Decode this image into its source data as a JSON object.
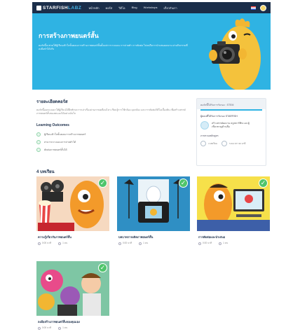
{
  "nav": {
    "logo_main": "STARFISH",
    "logo_accent": "LABZ",
    "items": [
      "หน้าหลัก",
      "คอร์ส",
      " วิดีโอ",
      "Blog",
      "Workshops",
      "เกี่ยวกับเรา"
    ],
    "icons": [
      "flag-icon",
      "user-avatar-icon"
    ]
  },
  "hero": {
    "title": "การสร้างภาพยนตร์สั้น",
    "description": "คอร์สนี้จะช่วยให้ผู้เรียนเข้าใจขั้นตอนการสร้างภาพยนตร์สั้นตั้งแต่การวางแผน การถ่ายทำ การตัดต่อ ไปจนถึงการนำเสนอผลงาน ผ่านกิจกรรมที่ลงมือทำได้จริง"
  },
  "about": {
    "title": "รายละเอียดคอร์ส",
    "description": "คอร์สนี้ออกแบบมาให้ผู้เรียนได้ฝึกทักษะการเล่าเรื่องผ่านภาพเคลื่อนไหว เรียนรู้การใช้กล้อง มุมกล้อง และการตัดต่อวิดีโอเบื้องต้น เพื่อสร้างสรรค์ภาพยนตร์สั้นของตนเองได้อย่างมั่นใจ",
    "outcomes_title": "Learning Outcomes",
    "outcomes": [
      "ผู้เรียนเข้าใจขั้นตอนการสร้างภาพยนตร์",
      "สามารถวางแผนการถ่ายทำได้",
      "ตัดต่อภาพยนตร์สั้นได้"
    ]
  },
  "sidebar": {
    "header": "คอร์สนี้ได้รับการรับรอง : STEM",
    "teacher_label": "ผู้สอนที่ได้รับการรับรอง STARFISH",
    "teacher_name": "สร้างสรรค์ผลงาน ครูสตาร์ฟิช และผู้เชี่ยวชาญด้านสื่อ",
    "stats_label": "ภาพรวมหลักสูตร",
    "stats": [
      {
        "icon": "lesson-count-icon",
        "text": "4 บทเรียน"
      },
      {
        "icon": "duration-icon",
        "text": "ระยะเวลา 30 นาที"
      }
    ]
  },
  "lessons_title": "4 บทเรียน",
  "lessons": [
    {
      "title": "ความรู้เกี่ยวกับภาพยนตร์สั้น",
      "duration": "0:00 นาที",
      "learners": "1 คน"
    },
    {
      "title": "บทบาทการผลิตภาพยนตร์สั้น",
      "duration": "0:00 นาที",
      "learners": "1 คน"
    },
    {
      "title": "การตัดต่อและนำเสนอ",
      "duration": "0:00 นาที",
      "learners": "1 คน"
    },
    {
      "title": "ลงมือสร้างภาพยนตร์สั้นของคุณเอง",
      "duration": "0:00 นาที",
      "learners": "1 คน"
    }
  ],
  "colors": {
    "hero_bg": "#2fb3e3",
    "nav_bg": "#1b2e4a",
    "check_green": "#4fc56b"
  }
}
